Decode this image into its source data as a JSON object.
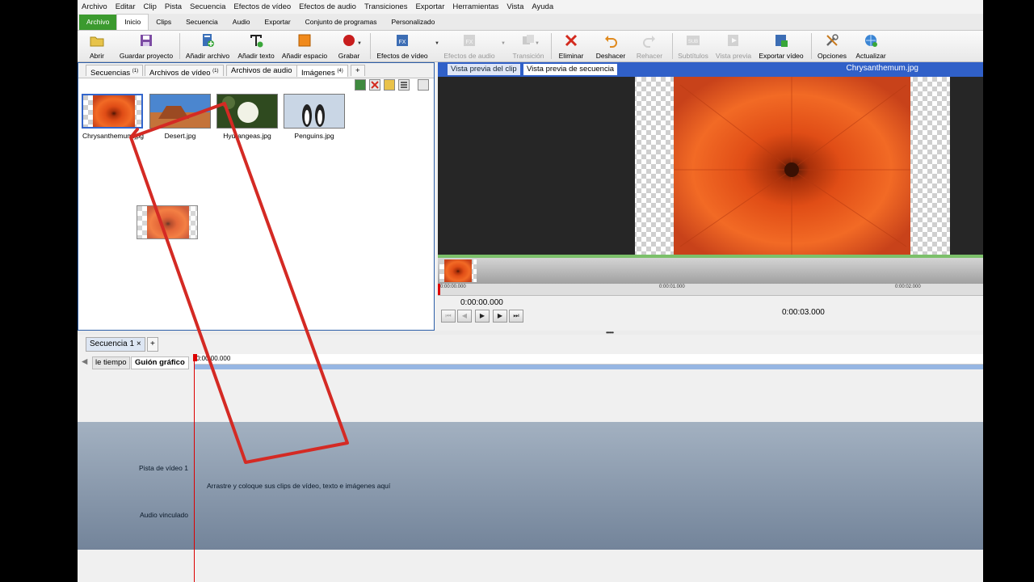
{
  "menubar": [
    "Archivo",
    "Editar",
    "Clip",
    "Pista",
    "Secuencia",
    "Efectos de vídeo",
    "Efectos de audio",
    "Transiciones",
    "Exportar",
    "Herramientas",
    "Vista",
    "Ayuda"
  ],
  "ribbon_tabs": [
    "Archivo",
    "Inicio",
    "Clips",
    "Secuencia",
    "Audio",
    "Exportar",
    "Conjunto de programas",
    "Personalizado"
  ],
  "toolbar": {
    "abrir": "Abrir",
    "guardar": "Guardar proyecto",
    "anadir_archivo": "Añadir archivo",
    "anadir_texto": "Añadir texto",
    "anadir_espacio": "Añadir espacio",
    "grabar": "Grabar",
    "efectos_video": "Efectos de vídeo",
    "efectos_audio": "Efectos de audio",
    "transicion": "Transición",
    "eliminar": "Eliminar",
    "deshacer": "Deshacer",
    "rehacer": "Rehacer",
    "subtitulos": "Subtítulos",
    "vista_previa": "Vista previa",
    "exportar_video": "Exportar vídeo",
    "opciones": "Opciones",
    "actualizar": "Actualizar"
  },
  "media_tabs": [
    {
      "label": "Secuencias",
      "count": "(1)"
    },
    {
      "label": "Archivos de vídeo",
      "count": "(1)"
    },
    {
      "label": "Archivos de audio",
      "count": ""
    },
    {
      "label": "Imágenes",
      "count": "(4)"
    }
  ],
  "add_tab": "+",
  "media_items": [
    "Chrysanthemum.jpg",
    "Desert.jpg",
    "Hydrangeas.jpg",
    "Penguins.jpg"
  ],
  "preview": {
    "tab_clip": "Vista previa del clip",
    "tab_sequence": "Vista previa de secuencia",
    "title": "Chrysanthemum.jpg",
    "ruler": [
      "0:00:00.000",
      "0:00:01.000",
      "0:00:02.000"
    ],
    "timecode": "0:00:00.000",
    "duration": "0:00:03.000"
  },
  "sequence": {
    "tab": "Secuencia 1",
    "close": "×",
    "add": "+"
  },
  "timeline": {
    "tab_timeline": "le tiempo",
    "tab_storyboard": "Guión gráfico",
    "ruler": "0:00:00.000",
    "track_video": "Pista de vídeo 1",
    "track_audio": "Audio vinculado",
    "hint": "Arrastre y coloque sus clips de vídeo, texto e imágenes aquí"
  },
  "colors": {
    "accent": "#3060c8",
    "archivo": "#3b9a2e",
    "annotation": "#d42a24",
    "flower": "#e8521c"
  }
}
